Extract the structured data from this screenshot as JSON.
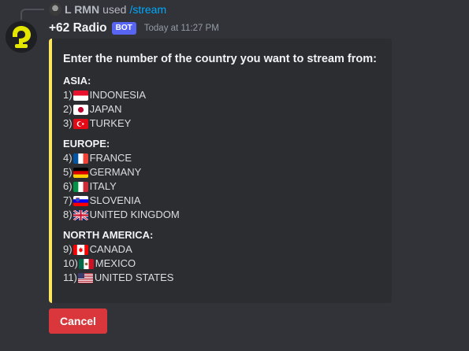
{
  "reply": {
    "user": "L RMN",
    "used_text": "used",
    "command": "/stream"
  },
  "message": {
    "username": "+62 Radio",
    "bot_tag": "BOT",
    "timestamp": "Today at 11:27 PM"
  },
  "embed": {
    "accent_color": "#fee75c",
    "title": "Enter the number of the country you want to stream from:",
    "regions": [
      {
        "name": "ASIA:",
        "countries": [
          {
            "num": "1)",
            "flag": "flag-indonesia",
            "name": "INDONESIA"
          },
          {
            "num": "2)",
            "flag": "flag-japan",
            "name": "JAPAN"
          },
          {
            "num": "3)",
            "flag": "flag-turkey",
            "name": "TURKEY"
          }
        ]
      },
      {
        "name": "EUROPE:",
        "countries": [
          {
            "num": "4)",
            "flag": "flag-france",
            "name": "FRANCE"
          },
          {
            "num": "5)",
            "flag": "flag-germany",
            "name": "GERMANY"
          },
          {
            "num": "6)",
            "flag": "flag-italy",
            "name": "ITALY"
          },
          {
            "num": "7)",
            "flag": "flag-slovenia",
            "name": "SLOVENIA"
          },
          {
            "num": "8)",
            "flag": "flag-united-kingdom",
            "name": "UNITED KINGDOM"
          }
        ]
      },
      {
        "name": "NORTH AMERICA:",
        "countries": [
          {
            "num": "9)",
            "flag": "flag-canada",
            "name": "CANADA"
          },
          {
            "num": "10)",
            "flag": "flag-mexico",
            "name": "MEXICO"
          },
          {
            "num": "11)",
            "flag": "flag-united-states",
            "name": "UNITED STATES"
          }
        ]
      }
    ]
  },
  "cancel_button": {
    "label": "Cancel",
    "color": "#da373c"
  },
  "colors": {
    "background": "#313338",
    "embed_background": "#2b2d31",
    "command_link": "#00a8fc",
    "bot_tag": "#5865f2"
  }
}
